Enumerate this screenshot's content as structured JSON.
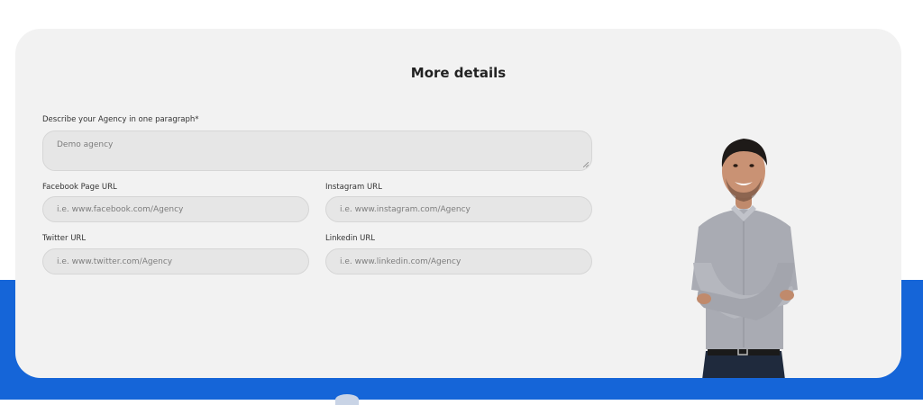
{
  "form": {
    "title": "More details",
    "description": {
      "label": "Describe your Agency in one paragraph*",
      "value": "Demo agency"
    },
    "facebook": {
      "label": "Facebook Page URL",
      "placeholder": "i.e. www.facebook.com/Agency"
    },
    "instagram": {
      "label": "Instagram URL",
      "placeholder": "i.e. www.instagram.com/Agency"
    },
    "twitter": {
      "label": "Twitter URL",
      "placeholder": "i.e. www.twitter.com/Agency"
    },
    "linkedin": {
      "label": "Linkedin URL",
      "placeholder": "i.e. www.linkedin.com/Agency"
    }
  },
  "colors": {
    "accent": "#1565d8",
    "card": "#f2f2f2",
    "field": "#e6e6e6"
  },
  "image": {
    "icon": "person-photo"
  }
}
